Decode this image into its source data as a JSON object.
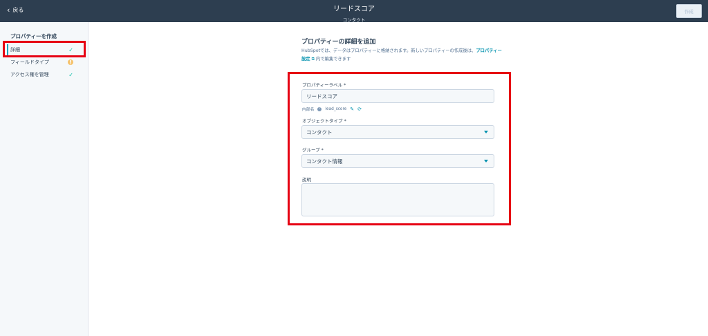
{
  "header": {
    "back_label": "戻る",
    "title": "リードスコア",
    "subtitle": "コンタクト",
    "create_label": "作成"
  },
  "sidebar": {
    "title": "プロパティーを作成",
    "items": [
      {
        "label": "詳細",
        "status": "check"
      },
      {
        "label": "フィールドタイプ",
        "status": "warning"
      },
      {
        "label": "アクセス権を管理",
        "status": "check"
      }
    ]
  },
  "main": {
    "title": "プロパティーの詳細を追加",
    "desc_prefix": "HubSpotでは、データはプロパティーに格納されます。新しいプロパティーの作成後は、",
    "desc_link": "プロパティー設定",
    "desc_suffix": "内で編集できます",
    "property_label": {
      "label": "プロパティーラベル *",
      "value": "リードスコア"
    },
    "internal_name": {
      "label": "内部名",
      "value": "lead_score"
    },
    "object_type": {
      "label": "オブジェクトタイプ *",
      "value": "コンタクト"
    },
    "group": {
      "label": "グループ *",
      "value": "コンタクト情報"
    },
    "description": {
      "label": "説明",
      "value": ""
    }
  },
  "colors": {
    "header_bg": "#2d3e50",
    "accent": "#00a4bd",
    "success": "#00bda5",
    "warning": "#f5c26b",
    "highlight": "#e60012"
  }
}
